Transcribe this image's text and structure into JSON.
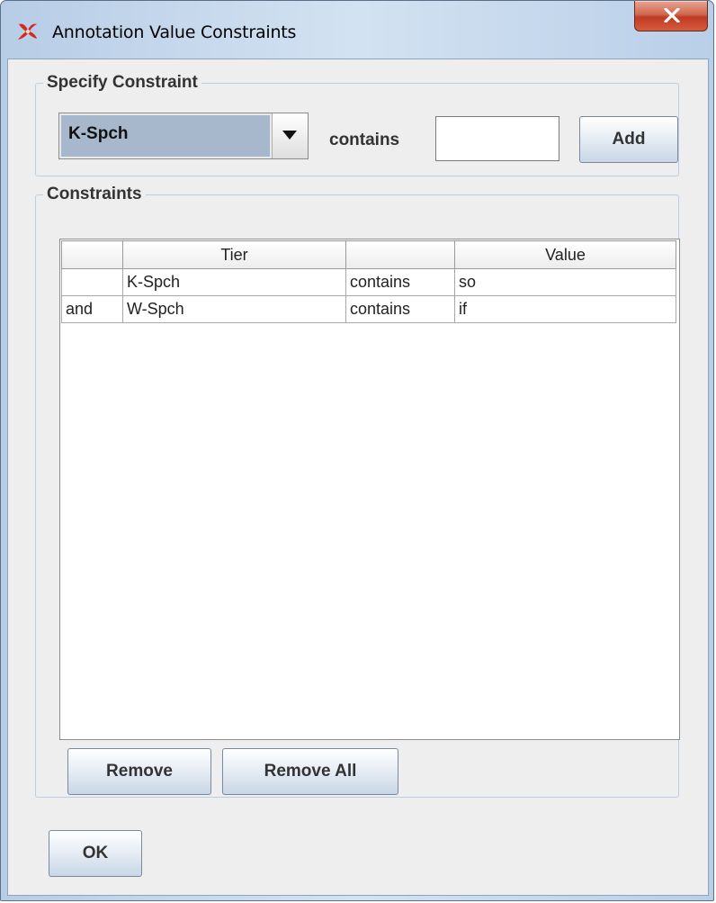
{
  "window": {
    "title": "Annotation Value Constraints"
  },
  "specify": {
    "group_title": "Specify Constraint",
    "tier_selected": "K-Spch",
    "operator_label": "contains",
    "value_input": "",
    "add_label": "Add"
  },
  "constraints": {
    "group_title": "Constraints",
    "columns": [
      "",
      "Tier",
      "",
      "Value"
    ],
    "rows": [
      {
        "connector": "",
        "tier": "K-Spch",
        "operator": "contains",
        "value": "so"
      },
      {
        "connector": "and",
        "tier": "W-Spch",
        "operator": "contains",
        "value": "if"
      }
    ],
    "remove_label": "Remove",
    "remove_all_label": "Remove All"
  },
  "ok_label": "OK",
  "colors": {
    "close_button": "#c9482f",
    "combo_selected": "#a8b8cc",
    "frame": "#c8dbef"
  }
}
